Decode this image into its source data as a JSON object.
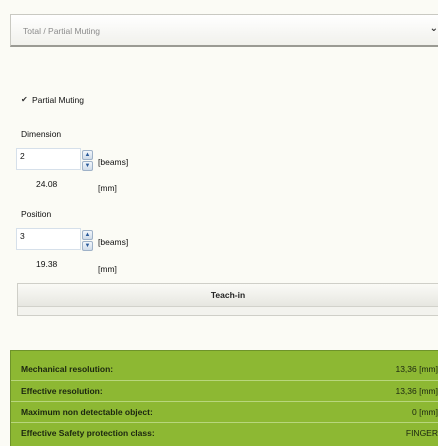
{
  "header": {
    "title": "Total / Partial Muting",
    "chevron_icon": "chevron-down-icon"
  },
  "partial_muting": {
    "checked": true,
    "label": "Partial Muting"
  },
  "dimension": {
    "label": "Dimension",
    "value": "2",
    "unit_beams": "[beams]",
    "computed_value": "24.08",
    "unit_mm": "[mm]"
  },
  "position": {
    "label": "Position",
    "value": "3",
    "unit_beams": "[beams]",
    "computed_value": "19.38",
    "unit_mm": "[mm]"
  },
  "teach_in": {
    "label": "Teach-in"
  },
  "results": [
    {
      "label": "Mechanical resolution:",
      "value": "13,36 [mm]"
    },
    {
      "label": "Effective resolution:",
      "value": "13,36 [mm]"
    },
    {
      "label": "Maximum non detectable object:",
      "value": "0 [mm]"
    },
    {
      "label": "Effective Safety protection class:",
      "value": "FINGER"
    }
  ],
  "colors": {
    "results_bg": "#8db833",
    "page_bg": "#fbfbf5"
  }
}
